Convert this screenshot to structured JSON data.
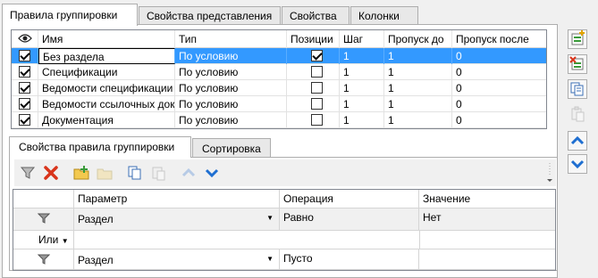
{
  "tabs": [
    "Правила группировки",
    "Свойства представления",
    "Свойства",
    "Колонки"
  ],
  "grid": {
    "columns": [
      "Имя",
      "Тип",
      "Позиции",
      "Шаг",
      "Пропуск до",
      "Пропуск после"
    ],
    "rows": [
      {
        "name": "Без раздела",
        "type": "По условию",
        "pos": true,
        "step": "1",
        "skip_before": "1",
        "skip_after": "0"
      },
      {
        "name": "Спецификации",
        "type": "По условию",
        "pos": false,
        "step": "1",
        "skip_before": "1",
        "skip_after": "0"
      },
      {
        "name": "Ведомости спецификации",
        "type": "По условию",
        "pos": false,
        "step": "1",
        "skip_before": "1",
        "skip_after": "0"
      },
      {
        "name": "Ведомости ссылочных док",
        "type": "По условию",
        "pos": false,
        "step": "1",
        "skip_before": "1",
        "skip_after": "0"
      },
      {
        "name": "Документация",
        "type": "По условию",
        "pos": false,
        "step": "1",
        "skip_before": "1",
        "skip_after": "0"
      }
    ]
  },
  "bottom_tabs": [
    "Свойства правила группировки",
    "Сортировка"
  ],
  "conditions": {
    "columns": [
      "Параметр",
      "Операция",
      "Значение"
    ],
    "rows": [
      {
        "param": "Раздел",
        "op": "Равно",
        "value": "Нет"
      },
      {
        "logic": "Или"
      },
      {
        "param": "Раздел",
        "op": "Пусто",
        "value": ""
      }
    ]
  },
  "icons": {
    "side": [
      "add-group-icon",
      "delete-group-icon",
      "copy-icon",
      "paste-icon",
      "move-up-icon",
      "move-down-icon"
    ],
    "toolbar": [
      "filter-icon",
      "delete-icon",
      "add-folder-icon",
      "folder-icon",
      "copy-icon",
      "paste-icon",
      "move-up-icon",
      "move-down-icon"
    ]
  },
  "colors": {
    "selection": "#3399ff",
    "accent_blue": "#1f6fd1",
    "delete_red": "#d9341b"
  }
}
